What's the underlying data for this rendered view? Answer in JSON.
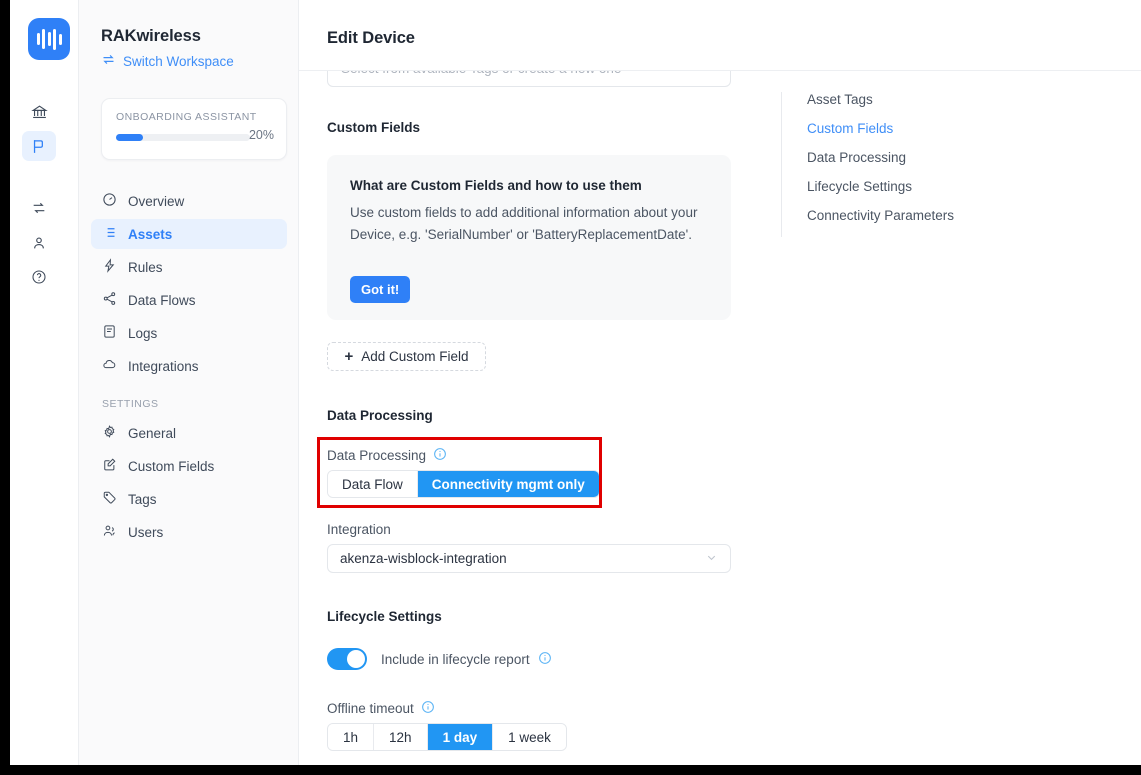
{
  "window": {
    "title": "Edit Device"
  },
  "rail": {
    "logo_icon": "waveform-logo-icon",
    "items": [
      {
        "icon": "bank-icon",
        "name": "organization"
      },
      {
        "icon": "flag-icon",
        "name": "workspace",
        "active": true
      },
      {
        "icon": "sync-icon",
        "name": "transfer"
      },
      {
        "icon": "user-icon",
        "name": "account"
      },
      {
        "icon": "help-icon",
        "name": "help"
      }
    ]
  },
  "sidebar": {
    "workspace_name": "RAKwireless",
    "switch_workspace_label": "Switch Workspace",
    "switch_workspace_icon": "swap-arrows-icon",
    "onboarding": {
      "label": "ONBOARDING ASSISTANT",
      "percent_label": "20%",
      "percent_value": 20
    },
    "nav": [
      {
        "label": "Overview",
        "icon": "gauge-icon"
      },
      {
        "label": "Assets",
        "icon": "list-icon",
        "active": true
      },
      {
        "label": "Rules",
        "icon": "bolt-icon"
      },
      {
        "label": "Data Flows",
        "icon": "share-icon"
      },
      {
        "label": "Logs",
        "icon": "document-icon"
      },
      {
        "label": "Integrations",
        "icon": "cloud-icon"
      }
    ],
    "settings_section_label": "SETTINGS",
    "settings_nav": [
      {
        "label": "General",
        "icon": "gear-icon"
      },
      {
        "label": "Custom Fields",
        "icon": "edit-square-icon"
      },
      {
        "label": "Tags",
        "icon": "tag-icon"
      },
      {
        "label": "Users",
        "icon": "users-icon"
      }
    ]
  },
  "main": {
    "tags_input": {
      "placeholder": "Select from available Tags or create a new one",
      "value": ""
    },
    "custom_fields": {
      "heading": "Custom Fields",
      "info_title": "What are Custom Fields and how to use them",
      "info_body": "Use custom fields to add additional information about your Device, e.g. 'SerialNumber' or 'BatteryReplacementDate'.",
      "got_it_label": "Got it!",
      "add_label": "Add Custom Field",
      "add_icon": "plus-icon"
    },
    "data_processing": {
      "heading": "Data Processing",
      "field_label": "Data Processing",
      "info_icon": "info-circle-icon",
      "options": [
        "Data Flow",
        "Connectivity mgmt only"
      ],
      "selected": "Connectivity mgmt only",
      "integration_label": "Integration",
      "integration_value": "akenza-wisblock-integration",
      "integration_chevron": "chevron-down-icon"
    },
    "lifecycle": {
      "heading": "Lifecycle Settings",
      "toggle_label": "Include in lifecycle report",
      "toggle_on": true,
      "toggle_info_icon": "info-circle-icon",
      "offline_label": "Offline timeout",
      "offline_info_icon": "info-circle-icon",
      "offline_options": [
        "1h",
        "12h",
        "1 day",
        "1 week"
      ],
      "offline_selected": "1 day"
    }
  },
  "anchors": {
    "items": [
      {
        "label": "Asset Tags"
      },
      {
        "label": "Custom Fields",
        "active": true
      },
      {
        "label": "Data Processing"
      },
      {
        "label": "Lifecycle Settings"
      },
      {
        "label": "Connectivity Parameters"
      }
    ]
  },
  "annotation": {
    "highlight_color": "#e00000",
    "target": "data-processing-toggle"
  },
  "colors": {
    "accent": "#2f80f7",
    "segment_active": "#2196f3",
    "link": "#3f8ef7",
    "sidebar_bg": "#fafafb",
    "annotation": "#e00000"
  }
}
